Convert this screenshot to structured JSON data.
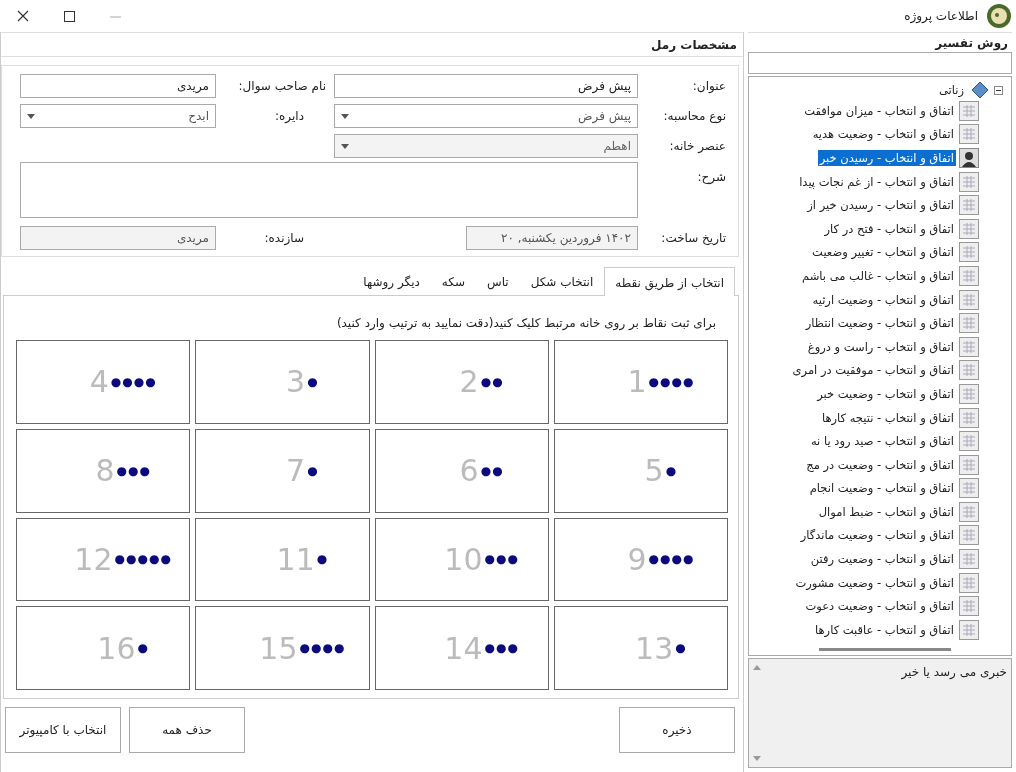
{
  "window": {
    "title": "اطلاعات پروژه"
  },
  "form": {
    "title": "مشخصات رمل",
    "fields": [
      {
        "label": "عنوان:",
        "value": "پیش فرض",
        "kind": "text",
        "disabled": false
      },
      {
        "label": "نام صاحب سوال:",
        "value": "مریدی",
        "kind": "text",
        "disabled": false
      },
      {
        "label": "نوع محاسبه:",
        "value": "پیش فرض",
        "kind": "select",
        "disabled": false
      },
      {
        "label": "دایره:",
        "value": "ابدح",
        "kind": "select",
        "disabled": false
      },
      {
        "label": "عنصر خانه:",
        "value": "اهطم",
        "kind": "select",
        "disabled": true
      },
      {
        "label": "شرح:",
        "kind": "textarea",
        "disabled": false
      },
      {
        "label": "تاریخ ساخت:",
        "value": "۱۴۰۲ فروردین یکشنبه, ۲۰",
        "kind": "text",
        "disabled": true
      },
      {
        "label": "سازنده:",
        "value": "مریدی",
        "kind": "text",
        "disabled": true
      }
    ]
  },
  "tabs": [
    {
      "label": "انتخاب از طریق نقطه",
      "selected": true
    },
    {
      "label": "انتخاب شکل",
      "selected": false
    },
    {
      "label": "تاس",
      "selected": false
    },
    {
      "label": "سکه",
      "selected": false
    },
    {
      "label": "دیگر روشها",
      "selected": false
    }
  ],
  "instruction": "برای ثبت نقاط بر روی خانه مرتبط کلیک کنید(دقت نمایید به ترتیب وارد کنید)",
  "cells": [
    {
      "number": "1",
      "dots": "●●●●"
    },
    {
      "number": "2",
      "dots": "●●"
    },
    {
      "number": "3",
      "dots": "●"
    },
    {
      "number": "4",
      "dots": "●●●●"
    },
    {
      "number": "5",
      "dots": "●"
    },
    {
      "number": "6",
      "dots": "●●"
    },
    {
      "number": "7",
      "dots": "●"
    },
    {
      "number": "8",
      "dots": "●●●"
    },
    {
      "number": "9",
      "dots": "●●●●"
    },
    {
      "number": "10",
      "dots": "●●●"
    },
    {
      "number": "11",
      "dots": "●"
    },
    {
      "number": "12",
      "dots": "●●●●●"
    },
    {
      "number": "13",
      "dots": "●"
    },
    {
      "number": "14",
      "dots": "●●●"
    },
    {
      "number": "15",
      "dots": "●●●●"
    },
    {
      "number": "16",
      "dots": "●"
    }
  ],
  "buttons": [
    "ذخیره",
    "حذف همه",
    "انتخاب با کامپیوتر"
  ],
  "sidebar": {
    "title": "روش تفسیر",
    "tree": [
      {
        "label": "زناتی",
        "expanded": true,
        "children": [
          {
            "label": "اتفاق و انتخاب - میزان موافقت",
            "selected": false
          },
          {
            "label": "اتفاق و انتخاب - وضعیت هدیه",
            "selected": false
          },
          {
            "label": "اتفاق و انتخاب - رسیدن خبر",
            "selected": true
          },
          {
            "label": "اتفاق و انتخاب - از غم نجات پیدا",
            "selected": false
          },
          {
            "label": "اتفاق و انتخاب - رسیدن خیر از",
            "selected": false
          },
          {
            "label": "اتفاق و انتخاب - فتح در کار",
            "selected": false
          },
          {
            "label": "اتفاق و انتخاب - تغییر وضعیت",
            "selected": false
          },
          {
            "label": "اتفاق و انتخاب - غالب می باشم",
            "selected": false
          },
          {
            "label": "اتفاق و انتخاب - وضعیت ارثیه",
            "selected": false
          },
          {
            "label": "اتفاق و انتخاب - وضعیت انتظار",
            "selected": false
          },
          {
            "label": "اتفاق و انتخاب - راست و دروغ",
            "selected": false
          },
          {
            "label": "اتفاق و انتخاب - موفقیت در امری",
            "selected": false
          },
          {
            "label": "اتفاق و انتخاب - وضعیت خبر",
            "selected": false
          },
          {
            "label": "اتفاق و انتخاب - نتیجه کارها",
            "selected": false
          },
          {
            "label": "اتفاق و انتخاب - صید رود یا نه",
            "selected": false
          },
          {
            "label": "اتفاق و انتخاب - وضعیت در مج",
            "selected": false
          },
          {
            "label": "اتفاق و انتخاب - وضعیت انجام",
            "selected": false
          },
          {
            "label": "اتفاق و انتخاب - ضبط اموال",
            "selected": false
          },
          {
            "label": "اتفاق و انتخاب - وضعیت ماندگار",
            "selected": false
          },
          {
            "label": "اتفاق و انتخاب - وضعیت رفتن",
            "selected": false
          },
          {
            "label": "اتفاق و انتخاب - وضعیت مشورت",
            "selected": false
          },
          {
            "label": "اتفاق و انتخاب - وضعیت دعوت",
            "selected": false
          },
          {
            "label": "اتفاق و انتخاب - عاقبت کارها",
            "selected": false
          }
        ]
      }
    ]
  },
  "description": "خبری می رسد یا خیر"
}
